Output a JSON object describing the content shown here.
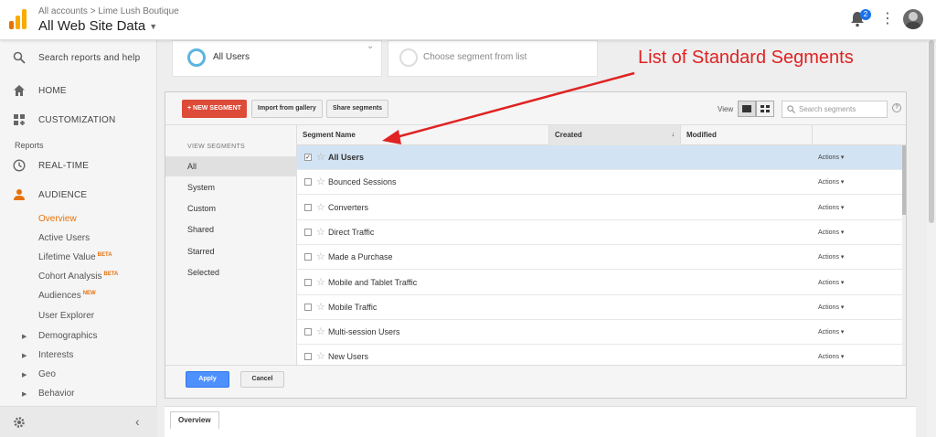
{
  "header": {
    "breadcrumb": "All accounts > Lime Lush Boutique",
    "property_title": "All Web Site Data",
    "notification_count": "2"
  },
  "sidebar": {
    "search_label": "Search reports and help",
    "home_label": "HOME",
    "customization_label": "CUSTOMIZATION",
    "reports_heading": "Reports",
    "realtime_label": "REAL-TIME",
    "audience_label": "AUDIENCE",
    "sub_items": [
      {
        "label": "Overview",
        "badge": ""
      },
      {
        "label": "Active Users",
        "badge": ""
      },
      {
        "label": "Lifetime Value",
        "badge": "BETA"
      },
      {
        "label": "Cohort Analysis",
        "badge": "BETA"
      },
      {
        "label": "Audiences",
        "badge": "NEW"
      },
      {
        "label": "User Explorer",
        "badge": ""
      }
    ],
    "expand_items": [
      "Demographics",
      "Interests",
      "Geo",
      "Behavior"
    ]
  },
  "segment_pickers": {
    "selected_segment": "All Users",
    "choose_placeholder": "Choose segment from list"
  },
  "toolbar": {
    "new_segment": "+ NEW SEGMENT",
    "import_gallery": "Import from gallery",
    "share_segments": "Share segments",
    "view_label": "View",
    "search_placeholder": "Search segments",
    "help": "?"
  },
  "view_segments": {
    "title": "VIEW SEGMENTS",
    "items": [
      "All",
      "System",
      "Custom",
      "Shared",
      "Starred",
      "Selected"
    ]
  },
  "table": {
    "columns": [
      "Segment Name",
      "Created",
      "Modified"
    ],
    "sort_indicator": "↓",
    "actions_label": "Actions",
    "rows": [
      {
        "name": "All Users",
        "checked": true
      },
      {
        "name": "Bounced Sessions",
        "checked": false
      },
      {
        "name": "Converters",
        "checked": false
      },
      {
        "name": "Direct Traffic",
        "checked": false
      },
      {
        "name": "Made a Purchase",
        "checked": false
      },
      {
        "name": "Mobile and Tablet Traffic",
        "checked": false
      },
      {
        "name": "Mobile Traffic",
        "checked": false
      },
      {
        "name": "Multi-session Users",
        "checked": false
      },
      {
        "name": "New Users",
        "checked": false
      }
    ]
  },
  "footer": {
    "apply": "Apply",
    "cancel": "Cancel"
  },
  "overview_tab": "Overview",
  "annotation": {
    "text": "List of Standard Segments",
    "color": "#e02222"
  },
  "colors": {
    "new_segment_red": "#dd4b39",
    "apply_blue": "#4d90fe",
    "active_orange": "#e8710a",
    "selected_row": "#d2e3f3"
  }
}
